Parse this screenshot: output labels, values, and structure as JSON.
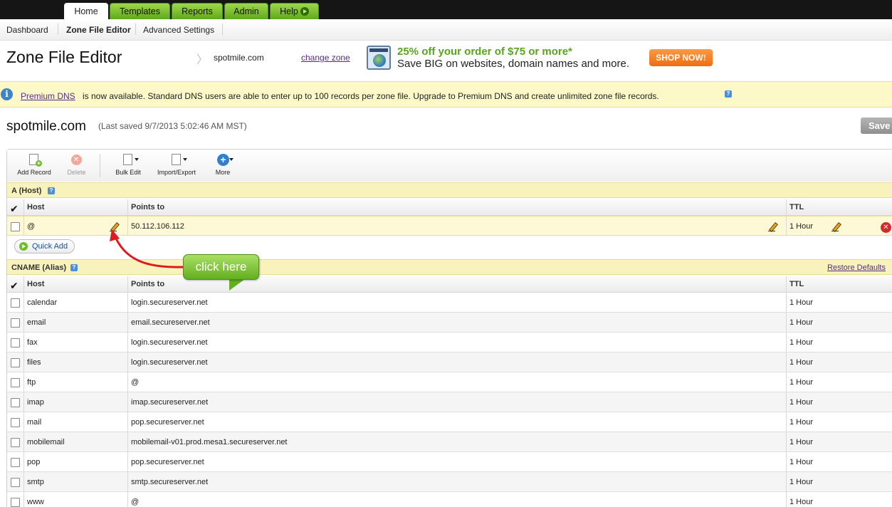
{
  "nav": {
    "tabs": [
      {
        "label": "Home"
      },
      {
        "label": "Templates"
      },
      {
        "label": "Reports"
      },
      {
        "label": "Admin"
      },
      {
        "label": "Help"
      }
    ]
  },
  "subnav": {
    "items": [
      {
        "label": "Dashboard"
      },
      {
        "label": "Zone File Editor"
      },
      {
        "label": "Advanced Settings"
      }
    ]
  },
  "header": {
    "title": "Zone File Editor",
    "zone": "spotmile.com",
    "change_zone": "change zone"
  },
  "promo": {
    "headline": "25% off your order of $75 or more*",
    "subline": "Save BIG on websites, domain names and more.",
    "button": "SHOP NOW!"
  },
  "banner": {
    "link": "Premium DNS",
    "message": "is now available. Standard DNS users are able to enter up to 100 records per zone file. Upgrade to Premium DNS and create unlimited zone file records."
  },
  "domain": {
    "name": "spotmile.com",
    "last_saved": "(Last saved 9/7/2013 5:02:46 AM MST)",
    "save_label": "Save"
  },
  "toolbar": {
    "add_record": "Add Record",
    "delete": "Delete",
    "bulk_edit": "Bulk Edit",
    "import_export": "Import/Export",
    "more": "More"
  },
  "a_section": {
    "title": "A (Host)",
    "columns": {
      "host": "Host",
      "points_to": "Points to",
      "ttl": "TTL"
    },
    "rows": [
      {
        "host": "@",
        "points_to": "50.112.106.112",
        "ttl": "1 Hour"
      }
    ],
    "quick_add": "Quick Add"
  },
  "callout": {
    "text": "click here"
  },
  "cname_section": {
    "title": "CNAME (Alias)",
    "restore": "Restore Defaults",
    "columns": {
      "host": "Host",
      "points_to": "Points to",
      "ttl": "TTL"
    },
    "rows": [
      {
        "host": "calendar",
        "points_to": "login.secureserver.net",
        "ttl": "1 Hour"
      },
      {
        "host": "email",
        "points_to": "email.secureserver.net",
        "ttl": "1 Hour"
      },
      {
        "host": "fax",
        "points_to": "login.secureserver.net",
        "ttl": "1 Hour"
      },
      {
        "host": "files",
        "points_to": "login.secureserver.net",
        "ttl": "1 Hour"
      },
      {
        "host": "ftp",
        "points_to": "@",
        "ttl": "1 Hour"
      },
      {
        "host": "imap",
        "points_to": "imap.secureserver.net",
        "ttl": "1 Hour"
      },
      {
        "host": "mail",
        "points_to": "pop.secureserver.net",
        "ttl": "1 Hour"
      },
      {
        "host": "mobilemail",
        "points_to": "mobilemail-v01.prod.mesa1.secureserver.net",
        "ttl": "1 Hour"
      },
      {
        "host": "pop",
        "points_to": "pop.secureserver.net",
        "ttl": "1 Hour"
      },
      {
        "host": "smtp",
        "points_to": "smtp.secureserver.net",
        "ttl": "1 Hour"
      },
      {
        "host": "www",
        "points_to": "@",
        "ttl": "1 Hour"
      }
    ]
  }
}
